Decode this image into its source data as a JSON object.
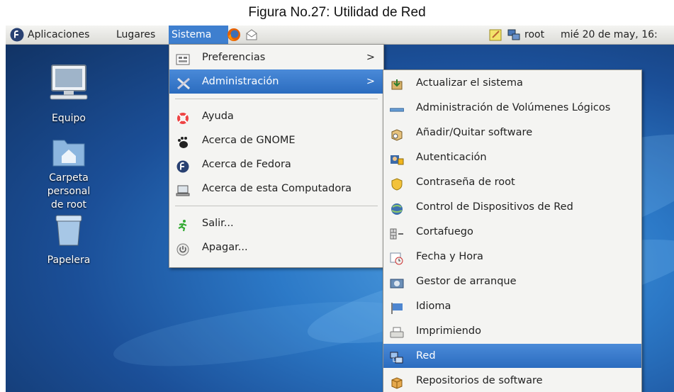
{
  "caption": "Figura No.27: Utilidad de Red",
  "panel": {
    "applications": "Aplicaciones",
    "places": "Lugares",
    "system": "Sistema",
    "user": "root",
    "datetime": "mié 20 de may, 16:"
  },
  "desktop": {
    "icons": [
      {
        "label": "Equipo"
      },
      {
        "label_line1": "Carpeta personal",
        "label_line2": "de root"
      },
      {
        "label": "Papelera"
      }
    ]
  },
  "system_menu": {
    "items": [
      {
        "label": "Preferencias",
        "submenu_arrow": ">"
      },
      {
        "label": "Administración",
        "submenu_arrow": ">"
      },
      {
        "label": "Ayuda"
      },
      {
        "label": "Acerca de GNOME"
      },
      {
        "label": "Acerca de Fedora"
      },
      {
        "label": "Acerca de esta Computadora"
      },
      {
        "label": "Salir..."
      },
      {
        "label": "Apagar..."
      }
    ],
    "highlighted": "Administración"
  },
  "admin_menu": {
    "items": [
      {
        "label": "Actualizar el sistema"
      },
      {
        "label": "Administración de Volúmenes Lógicos"
      },
      {
        "label": "Añadir/Quitar software"
      },
      {
        "label": "Autenticación"
      },
      {
        "label": "Contraseña de root"
      },
      {
        "label": "Control de Dispositivos de Red"
      },
      {
        "label": "Cortafuego"
      },
      {
        "label": "Fecha y Hora"
      },
      {
        "label": "Gestor de arranque"
      },
      {
        "label": "Idioma"
      },
      {
        "label": "Imprimiendo"
      },
      {
        "label": "Red"
      },
      {
        "label": "Repositorios de software"
      }
    ],
    "highlighted": "Red"
  },
  "colors": {
    "highlight": "#2b6cbf",
    "desktop_blue": "#2c79c7"
  }
}
